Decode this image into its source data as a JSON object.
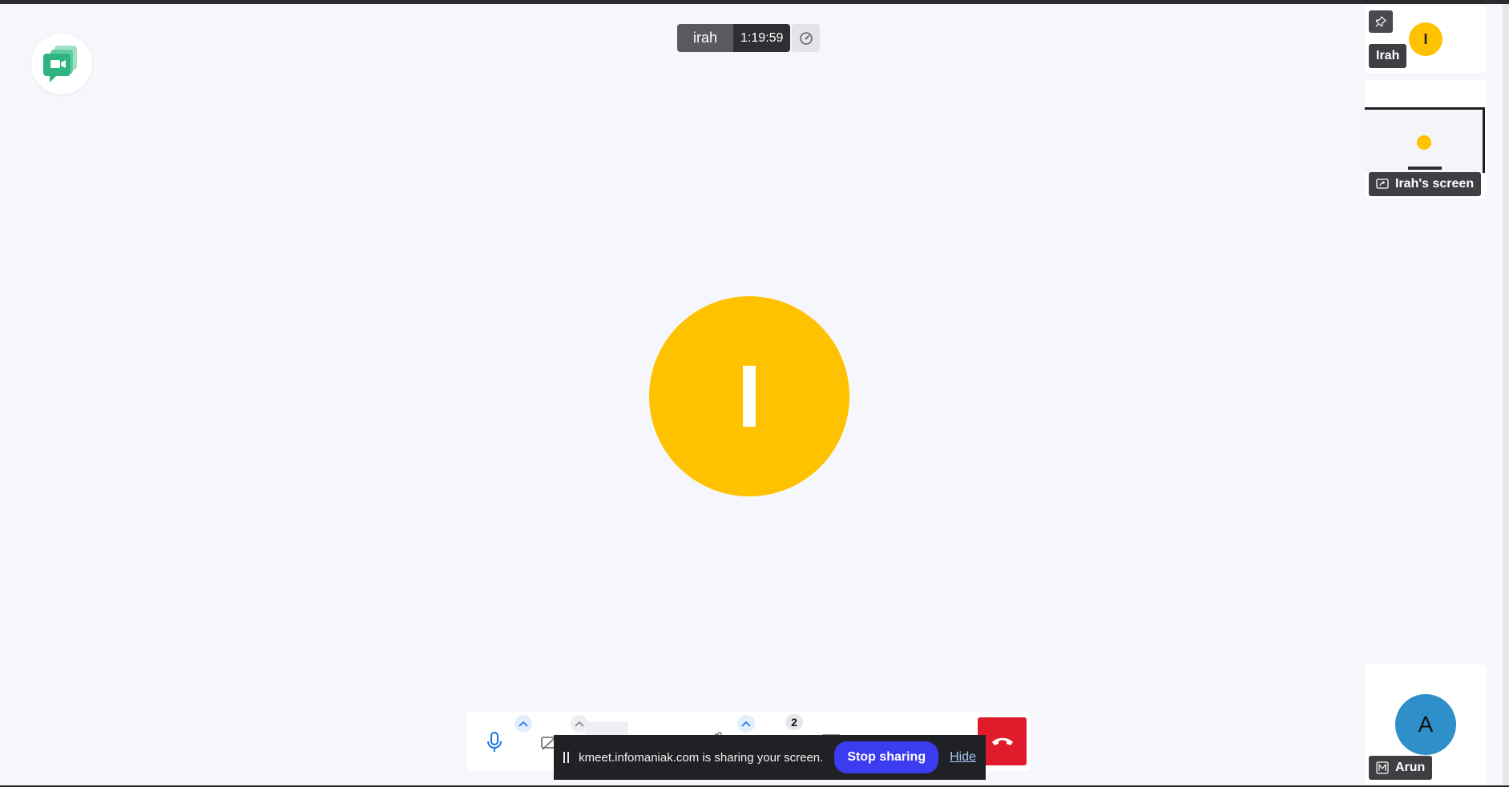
{
  "meeting": {
    "participant_name": "irah",
    "elapsed_time": "1:19:59",
    "speed_icon": "gauge-icon"
  },
  "main_stage": {
    "avatar_initial": "I",
    "avatar_color": "#ffc200"
  },
  "sidebar": {
    "tiles": [
      {
        "name": "Irah",
        "initial": "I",
        "avatar_color": "#ffc200",
        "pin_icon": "pin-icon"
      },
      {
        "name": "Irah's screen",
        "icon": "screen-share-icon"
      },
      {
        "name": "Arun",
        "initial": "A",
        "avatar_color": "#2f8fc9",
        "badge_icon": "moderator-icon"
      }
    ]
  },
  "toolbar": {
    "participants_count": "2",
    "hangup_color": "#e01b2b",
    "accent_color": "#1a73e8"
  },
  "share_notice": {
    "text": "kmeet.infomaniak.com is sharing your screen.",
    "stop_label": "Stop sharing",
    "hide_label": "Hide",
    "stop_color": "#3b3bf0"
  }
}
